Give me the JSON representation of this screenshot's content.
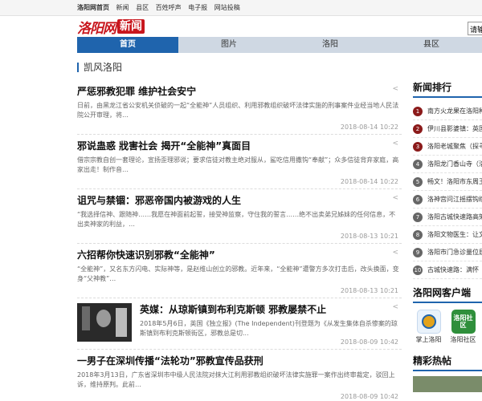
{
  "topbar": {
    "links": [
      "洛阳网首页",
      "新闻",
      "县区",
      "百姓呼声",
      "电子报",
      "网站投稿"
    ]
  },
  "logo": {
    "brush_text": "洛阳网",
    "news_label": "新闻"
  },
  "search": {
    "value": "请输"
  },
  "nav": {
    "tabs": [
      {
        "label": "首页",
        "active": true
      },
      {
        "label": "图片",
        "active": false
      },
      {
        "label": "洛阳",
        "active": false
      },
      {
        "label": "县区",
        "active": false
      }
    ]
  },
  "section": {
    "title": "凯风洛阳"
  },
  "articles": [
    {
      "title": "严惩邪教犯罪  维护社会安宁",
      "summary": "日前，由黑龙江省公安机关侦破的一起“全能神”人员组织、利用邪教组织破坏法律实施的刑事案件业经当地人民法院公开审理，将…",
      "date": "2018-08-14 10:22"
    },
    {
      "title": "邪说蛊惑  戕害社会  揭开“全能神”真面目",
      "summary": "借宗宗教自创一套理论，宣扬歪理邪说；要求信徒对教主绝对服从，鲨吃信用撒钩“奉献”；众多信徒背弃家庭，高家出走！制作音…",
      "date": "2018-08-14 10:22"
    },
    {
      "title": "诅咒与禁锢：邪恶帝国内被游戏的人生",
      "summary": "“我选择信神、跟随神……我愿在神面前起誓，接受神监察，守住我的誓言……绝不出卖弟兄姊妹的任何信息，不出卖神家的利益，…",
      "date": "2018-08-13 10:21"
    },
    {
      "title": "六招帮你快速识别邪教“全能神”",
      "summary": "“全能神”，又名东方闪电、实际神等，是赵维山创立的邪教。近年来，“全能神”遭警方多次打击后，改头换面，变身“父神教”…",
      "date": "2018-08-13 10:21"
    },
    {
      "title": "英媒：从琼斯镇到布利克斯顿  邪教屡禁不止",
      "summary": "2018年5月6日，英国《独立报》(The Independent)刊登题为《从发生集体自杀惨案的琼斯镇到布利克斯顿街区，邪教总是切...",
      "date": "2018-08-09 10:42",
      "has_thumb": true
    },
    {
      "title": "一男子在深圳传播“法轮功”邪教宣传品获刑",
      "summary": "2018年3月13日，广东省深圳市中级人民法院对抹大江利用邪教组织破坏法律实施罪一案作出终审裁定，驳回上诉，维持原判。此前…",
      "date": "2018-08-09 10:42"
    }
  ],
  "sidebar": {
    "rank_title": "新闻排行",
    "rank_items": [
      {
        "num": "1",
        "text": "南方火龙果在洛阳种",
        "hot": true
      },
      {
        "num": "2",
        "text": "伊川县影婆镇：英国",
        "hot": true
      },
      {
        "num": "3",
        "text": "洛阳老城聚焦（探寻",
        "hot": true
      },
      {
        "num": "4",
        "text": "洛阳龙门香山寺（洛",
        "hot": false
      },
      {
        "num": "5",
        "text": "畅文！洛阳市东周王",
        "hot": false
      },
      {
        "num": "6",
        "text": "洛神宫问江摇摆钩缤",
        "hot": false
      },
      {
        "num": "7",
        "text": "洛阳古城快速路高架",
        "hot": false
      },
      {
        "num": "8",
        "text": "洛阳文物医生：让文",
        "hot": false
      },
      {
        "num": "9",
        "text": "洛阳市门急诊量位居",
        "hot": false
      },
      {
        "num": "10",
        "text": "古城快速路：满怀",
        "hot": false
      }
    ],
    "client_title": "洛阳网客户端",
    "apps": [
      {
        "label": "掌上洛阳",
        "icon_text": ""
      },
      {
        "label": "洛阳社区",
        "icon_text": "洛阳社区"
      }
    ],
    "pics_title": "精彩热帖"
  },
  "colors": {
    "brand_red": "#c8161d",
    "nav_blue": "#1f64ad",
    "rank_hot": "#8b1a1a"
  }
}
